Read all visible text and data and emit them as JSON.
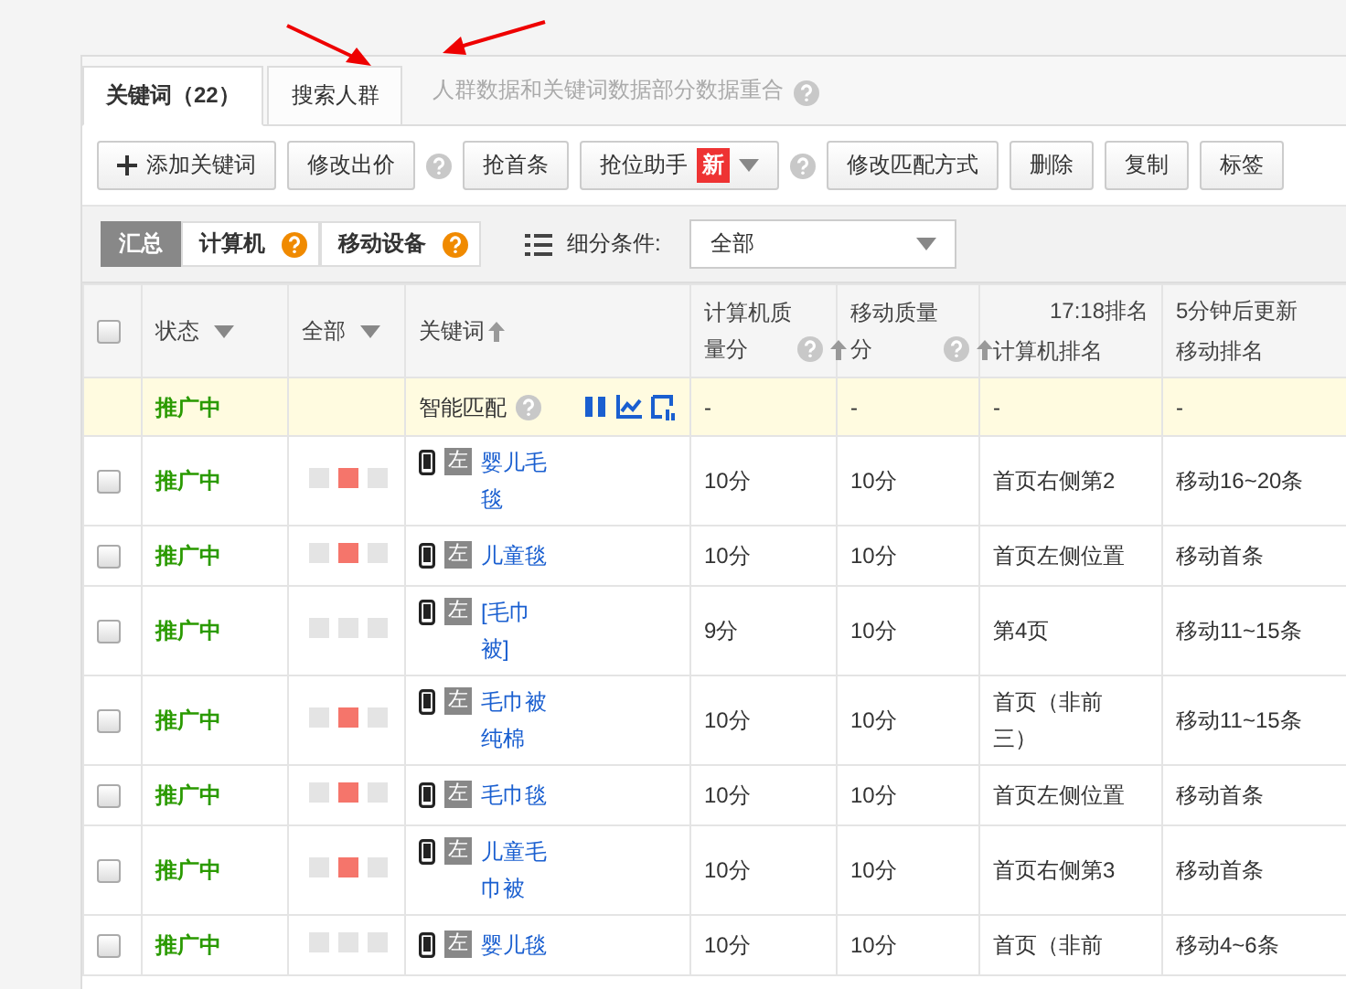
{
  "tabs": [
    {
      "label": "关键词（22）",
      "selected": true
    },
    {
      "label": "搜索人群",
      "selected": false
    }
  ],
  "tab_hint": "人群数据和关键词数据部分数据重合",
  "toolbar": [
    {
      "kind": "add",
      "label": "添加关键词"
    },
    {
      "kind": "button",
      "label": "修改出价",
      "help": true
    },
    {
      "kind": "button",
      "label": "抢首条"
    },
    {
      "kind": "dropdown",
      "label": "抢位助手",
      "badge": "新",
      "help": true
    },
    {
      "kind": "button",
      "label": "修改匹配方式"
    },
    {
      "kind": "button",
      "label": "删除"
    },
    {
      "kind": "button",
      "label": "复制"
    },
    {
      "kind": "button",
      "label": "标签"
    }
  ],
  "device_tabs": [
    {
      "label": "汇总",
      "selected": true,
      "help": false
    },
    {
      "label": "计算机",
      "selected": false,
      "help": true
    },
    {
      "label": "移动设备",
      "selected": false,
      "help": true
    }
  ],
  "filter": {
    "label": "细分条件:",
    "value": "全部"
  },
  "table": {
    "select_all": {
      "checked": false
    },
    "columns": {
      "status": "状态",
      "device": "全部",
      "keyword": "关键词",
      "pc_quality": "计算机质量分",
      "mobile_quality": "移动质量分",
      "rank_time": "17:18排名",
      "update": "5分钟后更新",
      "pc_rank": "计算机排名",
      "mobile_rank": "移动排名"
    },
    "smart_row": {
      "status": "推广中",
      "keyword": "智能匹配",
      "pc_quality": "-",
      "mobile_quality": "-",
      "pc_rank": "-",
      "mobile_rank": "-"
    },
    "rows": [
      {
        "checked": false,
        "status": "推广中",
        "squares": [
          false,
          true,
          false
        ],
        "tag": "左",
        "keyword": "婴儿毛毯",
        "pc_quality": "10分",
        "mobile_quality": "10分",
        "pc_rank": "首页右侧第2",
        "mobile_rank": "移动16~20条"
      },
      {
        "checked": false,
        "status": "推广中",
        "squares": [
          false,
          true,
          false
        ],
        "tag": "左",
        "keyword": "儿童毯",
        "pc_quality": "10分",
        "mobile_quality": "10分",
        "pc_rank": "首页左侧位置",
        "mobile_rank": "移动首条"
      },
      {
        "checked": false,
        "status": "推广中",
        "squares": [
          false,
          false,
          false
        ],
        "tag": "左",
        "keyword": "[毛巾被]",
        "pc_quality": "9分",
        "mobile_quality": "10分",
        "pc_rank": "第4页",
        "mobile_rank": "移动11~15条"
      },
      {
        "checked": false,
        "status": "推广中",
        "squares": [
          false,
          true,
          false
        ],
        "tag": "左",
        "keyword": "毛巾被纯棉",
        "pc_quality": "10分",
        "mobile_quality": "10分",
        "pc_rank": "首页（非前三）",
        "mobile_rank": "移动11~15条"
      },
      {
        "checked": false,
        "status": "推广中",
        "squares": [
          false,
          true,
          false
        ],
        "tag": "左",
        "keyword": "毛巾毯",
        "pc_quality": "10分",
        "mobile_quality": "10分",
        "pc_rank": "首页左侧位置",
        "mobile_rank": "移动首条"
      },
      {
        "checked": false,
        "status": "推广中",
        "squares": [
          false,
          true,
          false
        ],
        "tag": "左",
        "keyword": "儿童毛巾被",
        "pc_quality": "10分",
        "mobile_quality": "10分",
        "pc_rank": "首页右侧第3",
        "mobile_rank": "移动首条"
      },
      {
        "checked": false,
        "status": "推广中",
        "squares": [
          false,
          false,
          false
        ],
        "tag": "左",
        "keyword": "婴儿毯",
        "pc_quality": "10分",
        "mobile_quality": "10分",
        "pc_rank": "首页（非前",
        "mobile_rank": "移动4~6条"
      }
    ]
  }
}
